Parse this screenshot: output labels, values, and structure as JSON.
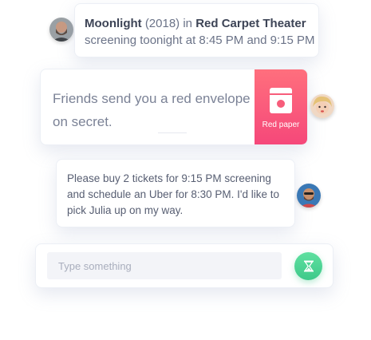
{
  "messages": [
    {
      "title": "Moonlight",
      "year": "(2018)",
      "in_word": "in",
      "venue": "Red Carpet Theater",
      "line2": "screening toonight at 8:45 PM and 9:15 PM"
    },
    {
      "text": "Friends send you a red envelope on secret.",
      "action_label": "Red paper",
      "action_icon": "red-envelope-icon"
    },
    {
      "text": "Please buy 2 tickets for 9:15 PM screening and schedule an Uber for 8:30 PM. I'd like to pick Julia up on my way."
    }
  ],
  "composer": {
    "placeholder": "Type something",
    "send_icon": "hourglass-icon"
  },
  "colors": {
    "accent_green": "#3ec98a",
    "accent_red": "#f5477a",
    "text_dark": "#3d4456",
    "text_muted": "#7b8296"
  }
}
